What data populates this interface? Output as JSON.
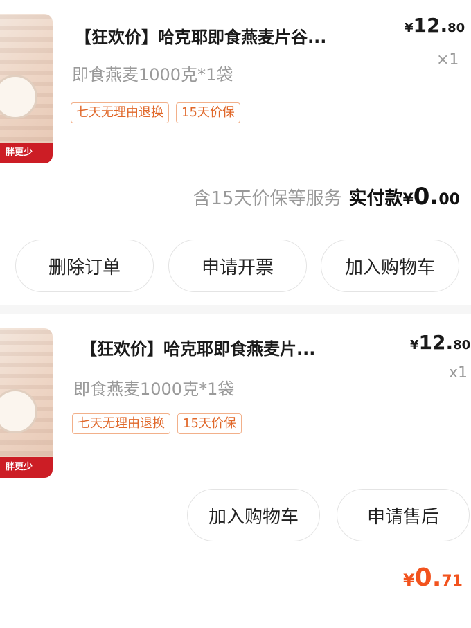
{
  "orders": [
    {
      "title": "【狂欢价】哈克耶即食燕麦片谷...",
      "spec": "即食燕麦1000克*1袋",
      "price": {
        "symbol": "¥",
        "int": "12.",
        "dec": "80"
      },
      "qty": "×1",
      "tags": [
        "七天无理由退换",
        "15天价保"
      ],
      "thumb_banner": "胖更少",
      "services": "含15天价保等服务",
      "paid_label": "实付款",
      "paid_amount": {
        "symbol": "¥",
        "int": "0.",
        "dec": "00"
      },
      "buttons": [
        "删除订单",
        "申请开票",
        "加入购物车"
      ]
    },
    {
      "title": "【狂欢价】哈克耶即食燕麦片...",
      "spec": "即食燕麦1000克*1袋",
      "price": {
        "symbol": "¥",
        "int": "12.",
        "dec": "80"
      },
      "qty": "x1",
      "tags": [
        "七天无理由退换",
        "15天价保"
      ],
      "thumb_banner": "胖更少",
      "buttons": [
        "加入购物车",
        "申请售后"
      ],
      "total": {
        "symbol": "¥",
        "int": "0.",
        "dec": "71"
      }
    }
  ],
  "colors": {
    "accent": "#f2531e",
    "tag_border": "#f2b08a",
    "tag_text": "#e0682a",
    "banner": "#cc1d25"
  }
}
